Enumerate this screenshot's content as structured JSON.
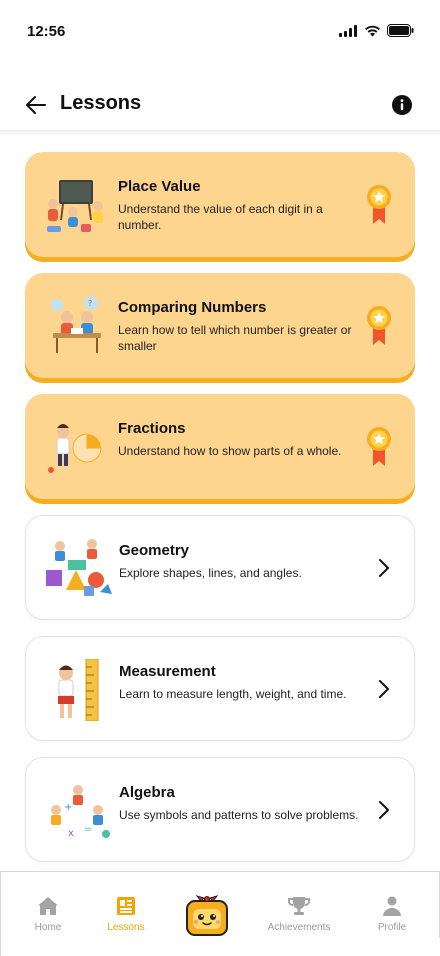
{
  "status": {
    "time": "12:56"
  },
  "header": {
    "title": "Lessons"
  },
  "lessons": [
    {
      "title": "Place Value",
      "description": "Understand the value of each digit in a number.",
      "completed": true,
      "illustration": "chalkboard-kids-illustration"
    },
    {
      "title": "Comparing Numbers",
      "description": "Learn how to tell which number is greater or smaller",
      "completed": true,
      "illustration": "kids-at-desk-illustration"
    },
    {
      "title": "Fractions",
      "description": "Understand how to show parts of a whole.",
      "completed": true,
      "illustration": "pie-fraction-illustration"
    },
    {
      "title": "Geometry",
      "description": "Explore shapes, lines, and angles.",
      "completed": false,
      "illustration": "shapes-kids-illustration"
    },
    {
      "title": "Measurement",
      "description": "Learn to measure length, weight, and time.",
      "completed": false,
      "illustration": "ruler-kid-illustration"
    },
    {
      "title": "Algebra",
      "description": "Use symbols and patterns to solve problems.",
      "completed": false,
      "illustration": "symbols-kids-illustration"
    }
  ],
  "tabs": [
    {
      "label": "Home",
      "icon": "home-icon",
      "active": false
    },
    {
      "label": "Lessons",
      "icon": "book-icon",
      "active": true
    },
    {
      "label": "Achievements",
      "icon": "trophy-icon",
      "active": false
    },
    {
      "label": "Profile",
      "icon": "person-icon",
      "active": false
    }
  ],
  "colors": {
    "completed_card": "#fed58f",
    "completed_card_edge": "#f6ad1f",
    "accent": "#f4a300",
    "inactive_tab": "#9a9a9a"
  }
}
